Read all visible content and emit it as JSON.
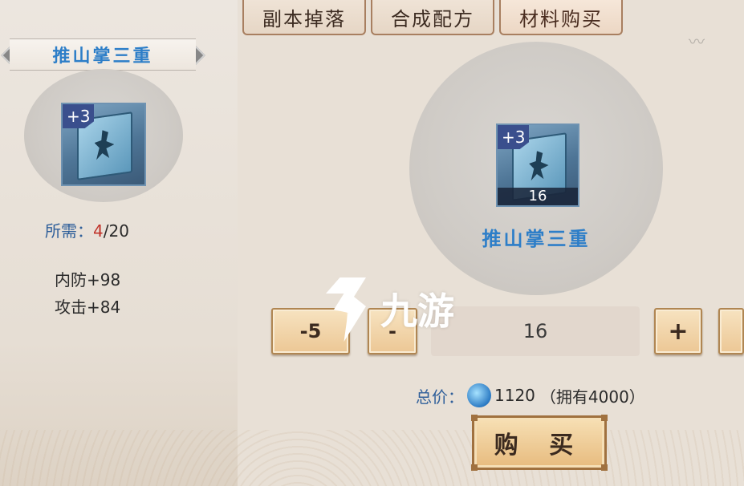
{
  "tabs": [
    {
      "label": "副本掉落",
      "active": false
    },
    {
      "label": "合成配方",
      "active": false
    },
    {
      "label": "材料购买",
      "active": true
    }
  ],
  "left_panel": {
    "item_name": "推山掌三重",
    "item_level_badge": "+3",
    "required_label": "所需：",
    "required_have": "4",
    "required_total": "/20",
    "stats": [
      "内防+98",
      "攻击+84"
    ]
  },
  "shop": {
    "item_name": "推山掌三重",
    "item_level_badge": "+3",
    "item_count": "16",
    "minus5_label": "-5",
    "minus1_label": "-",
    "quantity_value": "16",
    "plus1_label": "+",
    "total_label": "总价：",
    "total_value": "1120",
    "owned_text": "（拥有4000）",
    "buy_label": "购 买"
  },
  "watermark": {
    "text": "九游"
  },
  "colors": {
    "accent_blue": "#2d7ec8",
    "required_red": "#c0332a",
    "button_gold": "#ecc795"
  }
}
